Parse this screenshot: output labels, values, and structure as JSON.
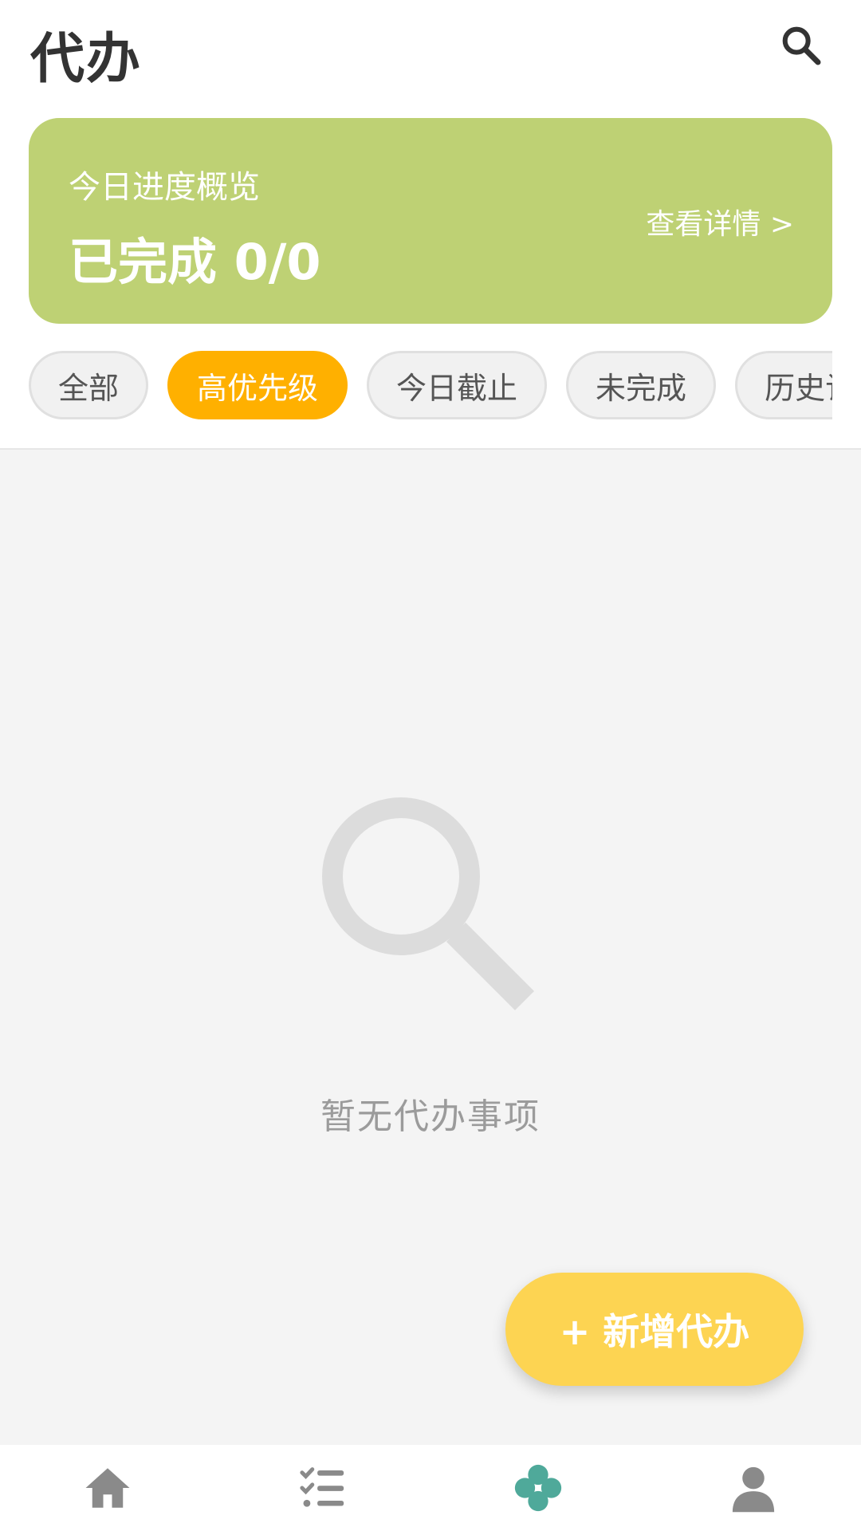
{
  "header": {
    "title": "代办"
  },
  "progress_card": {
    "subtitle": "今日进度概览",
    "completed": "已完成 0/0",
    "details_link": "查看详情 >"
  },
  "filters": {
    "active_index": 1,
    "items": [
      {
        "label": "全部"
      },
      {
        "label": "高优先级"
      },
      {
        "label": "今日截止"
      },
      {
        "label": "未完成"
      },
      {
        "label": "历史记录"
      }
    ]
  },
  "empty_state": {
    "icon": "search-icon",
    "text": "暂无代办事项"
  },
  "fab": {
    "label": "+ 新增代办"
  },
  "bottom_nav": {
    "active": "clover",
    "items": [
      {
        "icon": "home-icon"
      },
      {
        "icon": "task-list-icon"
      },
      {
        "icon": "clover-icon"
      },
      {
        "icon": "user-icon"
      }
    ]
  },
  "colors": {
    "card": "#bed174",
    "chip_active": "#ffb000",
    "fab": "#fdd452",
    "nav_active": "#4fa99a",
    "nav_inactive": "#8a8a8a"
  }
}
